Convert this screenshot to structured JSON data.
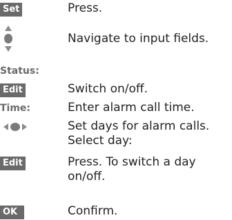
{
  "steps": [
    {
      "key": "Set",
      "text": "Press."
    },
    {
      "key_icon": "up-down-navigation-icon",
      "text": "Navigate to input fields."
    },
    {
      "label": "Status:"
    },
    {
      "key": "Edit",
      "text": "Switch on/off."
    },
    {
      "label": "Time:",
      "text": "Enter alarm call time."
    },
    {
      "key_icon": "left-right-navigation-icon",
      "text": "Set days for alarm calls. Select day:"
    },
    {
      "key": "Edit",
      "text": "Press. To switch a day on/off."
    },
    {
      "key": "OK",
      "text": "Confirm."
    }
  ],
  "colors": {
    "softkey_bg": "#6a6a6a",
    "softkey_text": "#ffffff",
    "label_text": "#6a6a6a",
    "body_text": "#222222"
  }
}
